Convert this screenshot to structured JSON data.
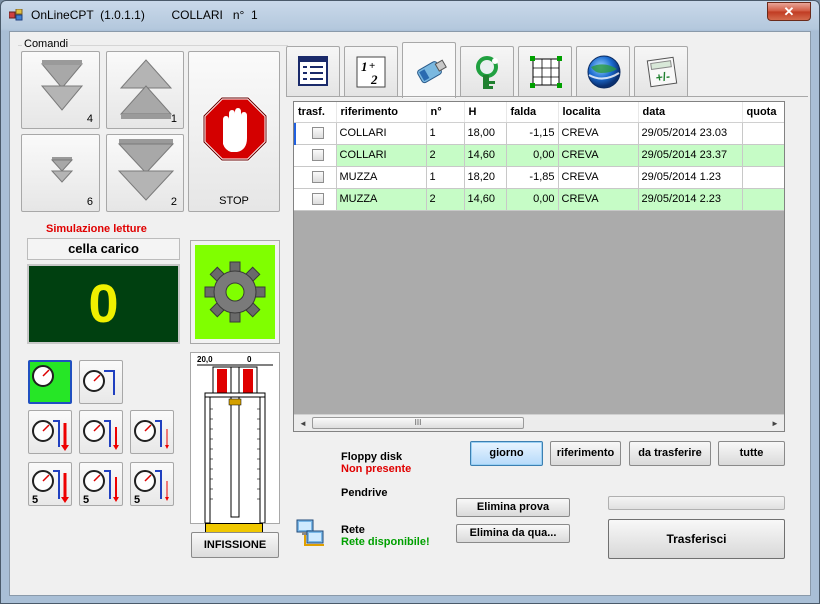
{
  "window": {
    "title": "OnLineCPT  (1.0.1.1)        COLLARI   n°  1",
    "close_glyph": "✕"
  },
  "commands": {
    "group_label": "Comandi",
    "buttons": [
      {
        "id": "down-4",
        "num": "4",
        "icon": "double-down-arrow-icon"
      },
      {
        "id": "up-1",
        "num": "1",
        "icon": "double-up-arrow-icon"
      },
      {
        "id": "down-6",
        "num": "6",
        "icon": "small-double-down-arrow-icon"
      },
      {
        "id": "down-2",
        "num": "2",
        "icon": "large-double-down-arrow-icon"
      }
    ],
    "stop_label": "STOP"
  },
  "simulation": {
    "title": "Simulazione letture",
    "cell_label": "cella carico",
    "reading_value": "0"
  },
  "gauges": {
    "row1": [
      "",
      ""
    ],
    "row2": [
      "",
      "",
      ""
    ],
    "row3": [
      "5",
      "5",
      "5"
    ]
  },
  "infissione": {
    "scale_left": "20,0",
    "scale_right": "0",
    "button_label": "INFISSIONE"
  },
  "tabs": [
    {
      "name": "tab-list",
      "icon": "list-icon"
    },
    {
      "name": "tab-numbering",
      "icon": "numbering-icon"
    },
    {
      "name": "tab-usb",
      "icon": "usb-drive-icon"
    },
    {
      "name": "tab-search-key",
      "icon": "search-key-icon"
    },
    {
      "name": "tab-map",
      "icon": "map-grid-icon"
    },
    {
      "name": "tab-globe",
      "icon": "globe-icon"
    },
    {
      "name": "tab-calculator",
      "icon": "calculator-icon"
    }
  ],
  "grid": {
    "columns": [
      "trasf.",
      "riferimento",
      "n°",
      "H",
      "falda",
      "localita",
      "data",
      "quota"
    ],
    "rows": [
      {
        "riferimento": "COLLARI",
        "n": "1",
        "H": "18,00",
        "falda": "-1,15",
        "localita": "CREVA",
        "data": "29/05/2014 23.03",
        "quota": "",
        "style": "white"
      },
      {
        "riferimento": "COLLARI",
        "n": "2",
        "H": "14,60",
        "falda": "0,00",
        "localita": "CREVA",
        "data": "29/05/2014 23.37",
        "quota": "",
        "style": "green"
      },
      {
        "riferimento": "MUZZA",
        "n": "1",
        "H": "18,20",
        "falda": "-1,85",
        "localita": "CREVA",
        "data": "29/05/2014 1.23",
        "quota": "",
        "style": "white"
      },
      {
        "riferimento": "MUZZA",
        "n": "2",
        "H": "14,60",
        "falda": "0,00",
        "localita": "CREVA",
        "data": "29/05/2014 2.23",
        "quota": "",
        "style": "green"
      }
    ],
    "scroll_left": "◄",
    "scroll_right": "►",
    "scroll_thumb": "III"
  },
  "filters": {
    "giorno": "giorno",
    "riferimento": "riferimento",
    "da_trasferire": "da trasferire",
    "tutte": "tutte"
  },
  "status": {
    "floppy_label": "Floppy disk",
    "floppy_value": "Non presente",
    "pendrive_label": "Pendrive",
    "rete_label": "Rete",
    "rete_value": "Rete disponibile!"
  },
  "actions": {
    "elimina_prova": "Elimina prova",
    "elimina_da_qua": "Elimina da qua...",
    "trasferisci": "Trasferisci"
  },
  "colors": {
    "reading_bg": "#004010",
    "reading_fg": "#f0f000",
    "gear_bg": "#80ff00",
    "row_green": "#c6fcc6",
    "stop_red": "#d40000"
  }
}
